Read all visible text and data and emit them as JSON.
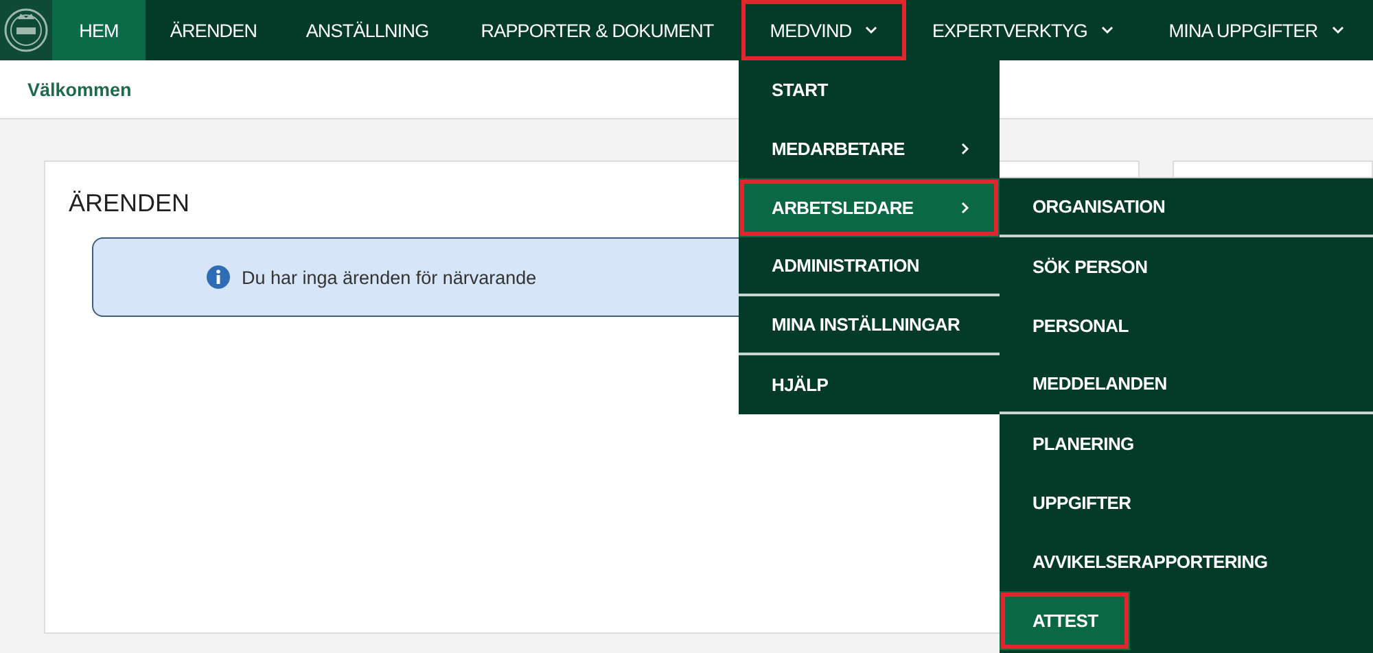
{
  "nav": {
    "items": [
      {
        "label": "HEM",
        "selected": true,
        "dropdown": false,
        "highlighted": false
      },
      {
        "label": "ÄRENDEN",
        "selected": false,
        "dropdown": false,
        "highlighted": false
      },
      {
        "label": "ANSTÄLLNING",
        "selected": false,
        "dropdown": false,
        "highlighted": false
      },
      {
        "label": "RAPPORTER & DOKUMENT",
        "selected": false,
        "dropdown": false,
        "highlighted": false
      },
      {
        "label": "MEDVIND",
        "selected": false,
        "dropdown": true,
        "highlighted": true
      },
      {
        "label": "EXPERTVERKTYG",
        "selected": false,
        "dropdown": true,
        "highlighted": false
      },
      {
        "label": "MINA UPPGIFTER",
        "selected": false,
        "dropdown": true,
        "highlighted": false
      }
    ]
  },
  "breadcrumb": "Välkommen",
  "card": {
    "title": "ÄRENDEN",
    "info": "Du har inga ärenden för närvarande"
  },
  "menu": {
    "items": [
      {
        "label": "START",
        "selected": false,
        "submenu": false,
        "highlighted": false,
        "divider": false
      },
      {
        "label": "MEDARBETARE",
        "selected": false,
        "submenu": true,
        "highlighted": false,
        "divider": false
      },
      {
        "label": "ARBETSLEDARE",
        "selected": true,
        "submenu": true,
        "highlighted": true,
        "divider": false
      },
      {
        "label": "ADMINISTRATION",
        "selected": false,
        "submenu": false,
        "highlighted": false,
        "divider": true
      },
      {
        "label": "MINA INSTÄLLNINGAR",
        "selected": false,
        "submenu": false,
        "highlighted": false,
        "divider": true
      },
      {
        "label": "HJÄLP",
        "selected": false,
        "submenu": false,
        "highlighted": false,
        "divider": false
      }
    ]
  },
  "submenu": {
    "items": [
      {
        "label": "ORGANISATION",
        "selected": false,
        "highlighted": false,
        "divider": true
      },
      {
        "label": "SÖK PERSON",
        "selected": false,
        "highlighted": false,
        "divider": false
      },
      {
        "label": "PERSONAL",
        "selected": false,
        "highlighted": false,
        "divider": false
      },
      {
        "label": "MEDDELANDEN",
        "selected": false,
        "highlighted": false,
        "divider": true
      },
      {
        "label": "PLANERING",
        "selected": false,
        "highlighted": false,
        "divider": false
      },
      {
        "label": "UPPGIFTER",
        "selected": false,
        "highlighted": false,
        "divider": false
      },
      {
        "label": "AVVIKELSERAPPORTERING",
        "selected": false,
        "highlighted": false,
        "divider": false
      },
      {
        "label": "ATTEST",
        "selected": true,
        "highlighted": true,
        "divider": false
      }
    ]
  }
}
